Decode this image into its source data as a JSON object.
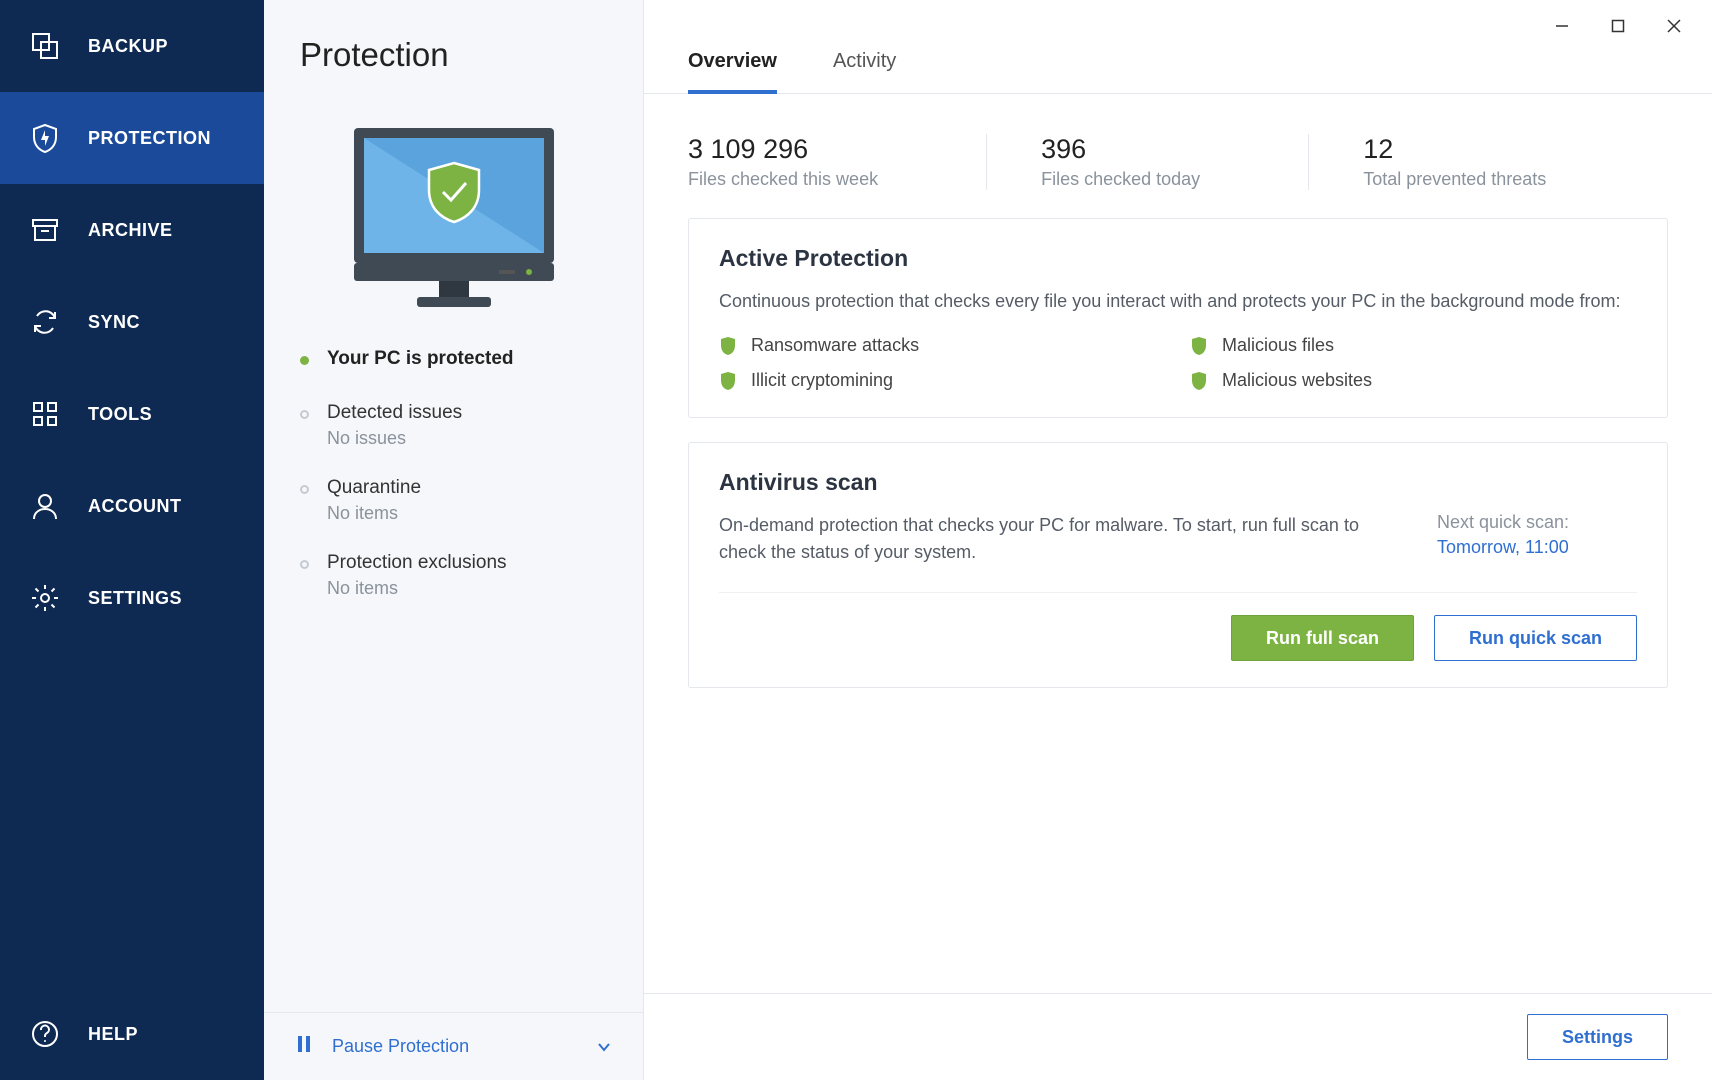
{
  "sidebar": {
    "items": [
      {
        "label": "BACKUP"
      },
      {
        "label": "PROTECTION"
      },
      {
        "label": "ARCHIVE"
      },
      {
        "label": "SYNC"
      },
      {
        "label": "TOOLS"
      },
      {
        "label": "ACCOUNT"
      },
      {
        "label": "SETTINGS"
      }
    ],
    "help_label": "HELP"
  },
  "left_panel": {
    "title": "Protection",
    "status_primary": "Your PC is protected",
    "detected_title": "Detected issues",
    "detected_sub": "No issues",
    "quarantine_title": "Quarantine",
    "quarantine_sub": "No items",
    "exclusions_title": "Protection exclusions",
    "exclusions_sub": "No items",
    "pause_label": "Pause Protection"
  },
  "tabs": {
    "overview": "Overview",
    "activity": "Activity"
  },
  "stats": [
    {
      "num": "3 109 296",
      "lbl": "Files checked this week"
    },
    {
      "num": "396",
      "lbl": "Files checked today"
    },
    {
      "num": "12",
      "lbl": "Total prevented threats"
    }
  ],
  "active_protection": {
    "title": "Active Protection",
    "desc": "Continuous protection that checks every file you interact with and protects your PC in the background mode from:",
    "threats": [
      "Ransomware attacks",
      "Malicious files",
      "Illicit cryptomining",
      "Malicious websites"
    ]
  },
  "antivirus": {
    "title": "Antivirus scan",
    "desc": "On-demand protection that checks your PC for malware. To start, run full scan to check the status of your system.",
    "next_label": "Next quick scan:",
    "next_value": "Tomorrow, 11:00",
    "full_btn": "Run full scan",
    "quick_btn": "Run quick scan"
  },
  "footer": {
    "settings": "Settings"
  },
  "colors": {
    "accent_blue": "#2f6fd0",
    "sidebar_bg": "#0f2a52",
    "active_green": "#7cb342"
  }
}
